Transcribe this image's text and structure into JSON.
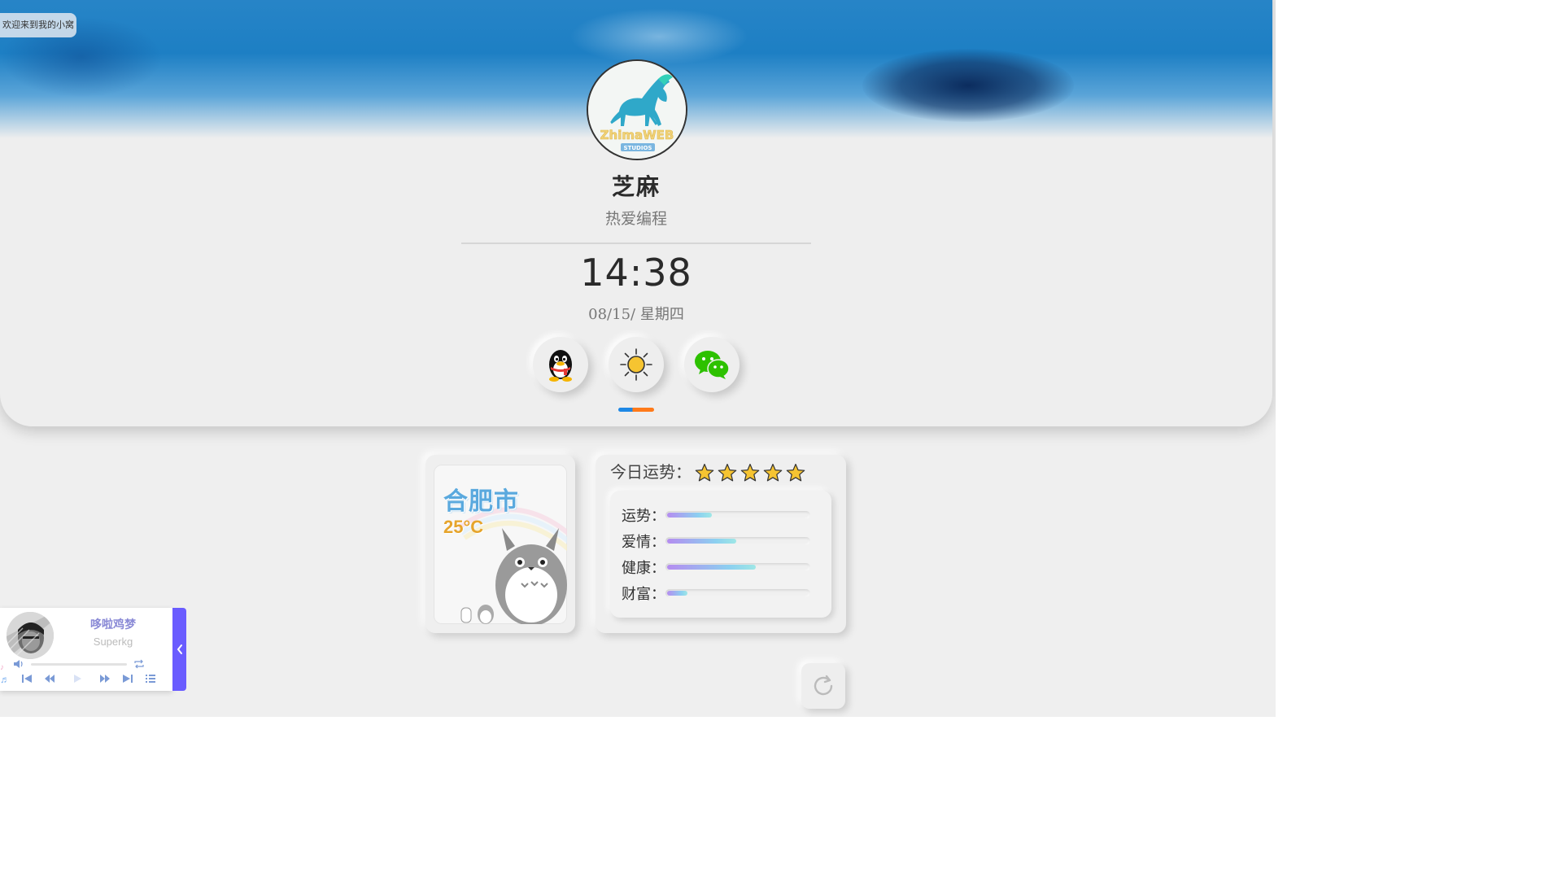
{
  "header": {
    "welcome_text": "欢迎来到我的小窝"
  },
  "profile": {
    "avatar_icon": "horse-logo-icon",
    "avatar_text": "ZhimaWEB",
    "avatar_subtext": "STUDIOS",
    "name": "芝麻",
    "motto": "热爱编程"
  },
  "clock": {
    "time": "14:38",
    "date": "08/15/  星期四"
  },
  "social": [
    {
      "name": "qq",
      "icon": "qq-penguin-icon"
    },
    {
      "name": "theme",
      "icon": "sun-icon"
    },
    {
      "name": "wechat",
      "icon": "wechat-icon"
    }
  ],
  "weather": {
    "city": "合肥市",
    "temperature": "25°C",
    "illustration": "totoro-icon"
  },
  "fortune": {
    "title": "今日运势：",
    "stars": 5,
    "items": [
      {
        "label": "运势：",
        "value": 0.31
      },
      {
        "label": "爱情：",
        "value": 0.48
      },
      {
        "label": "健康：",
        "value": 0.61
      },
      {
        "label": "财富：",
        "value": 0.14
      }
    ]
  },
  "player": {
    "title": "哆啦鸡梦",
    "artist": "Superkg",
    "progress": 0.0
  },
  "colors": {
    "accent_blue": "#1e88e5",
    "accent_orange": "#ff7a1a",
    "player_accent": "#6a5cff",
    "weather_city": "#5aa9de",
    "weather_temp": "#e6a42b",
    "star": "#f6c431"
  }
}
